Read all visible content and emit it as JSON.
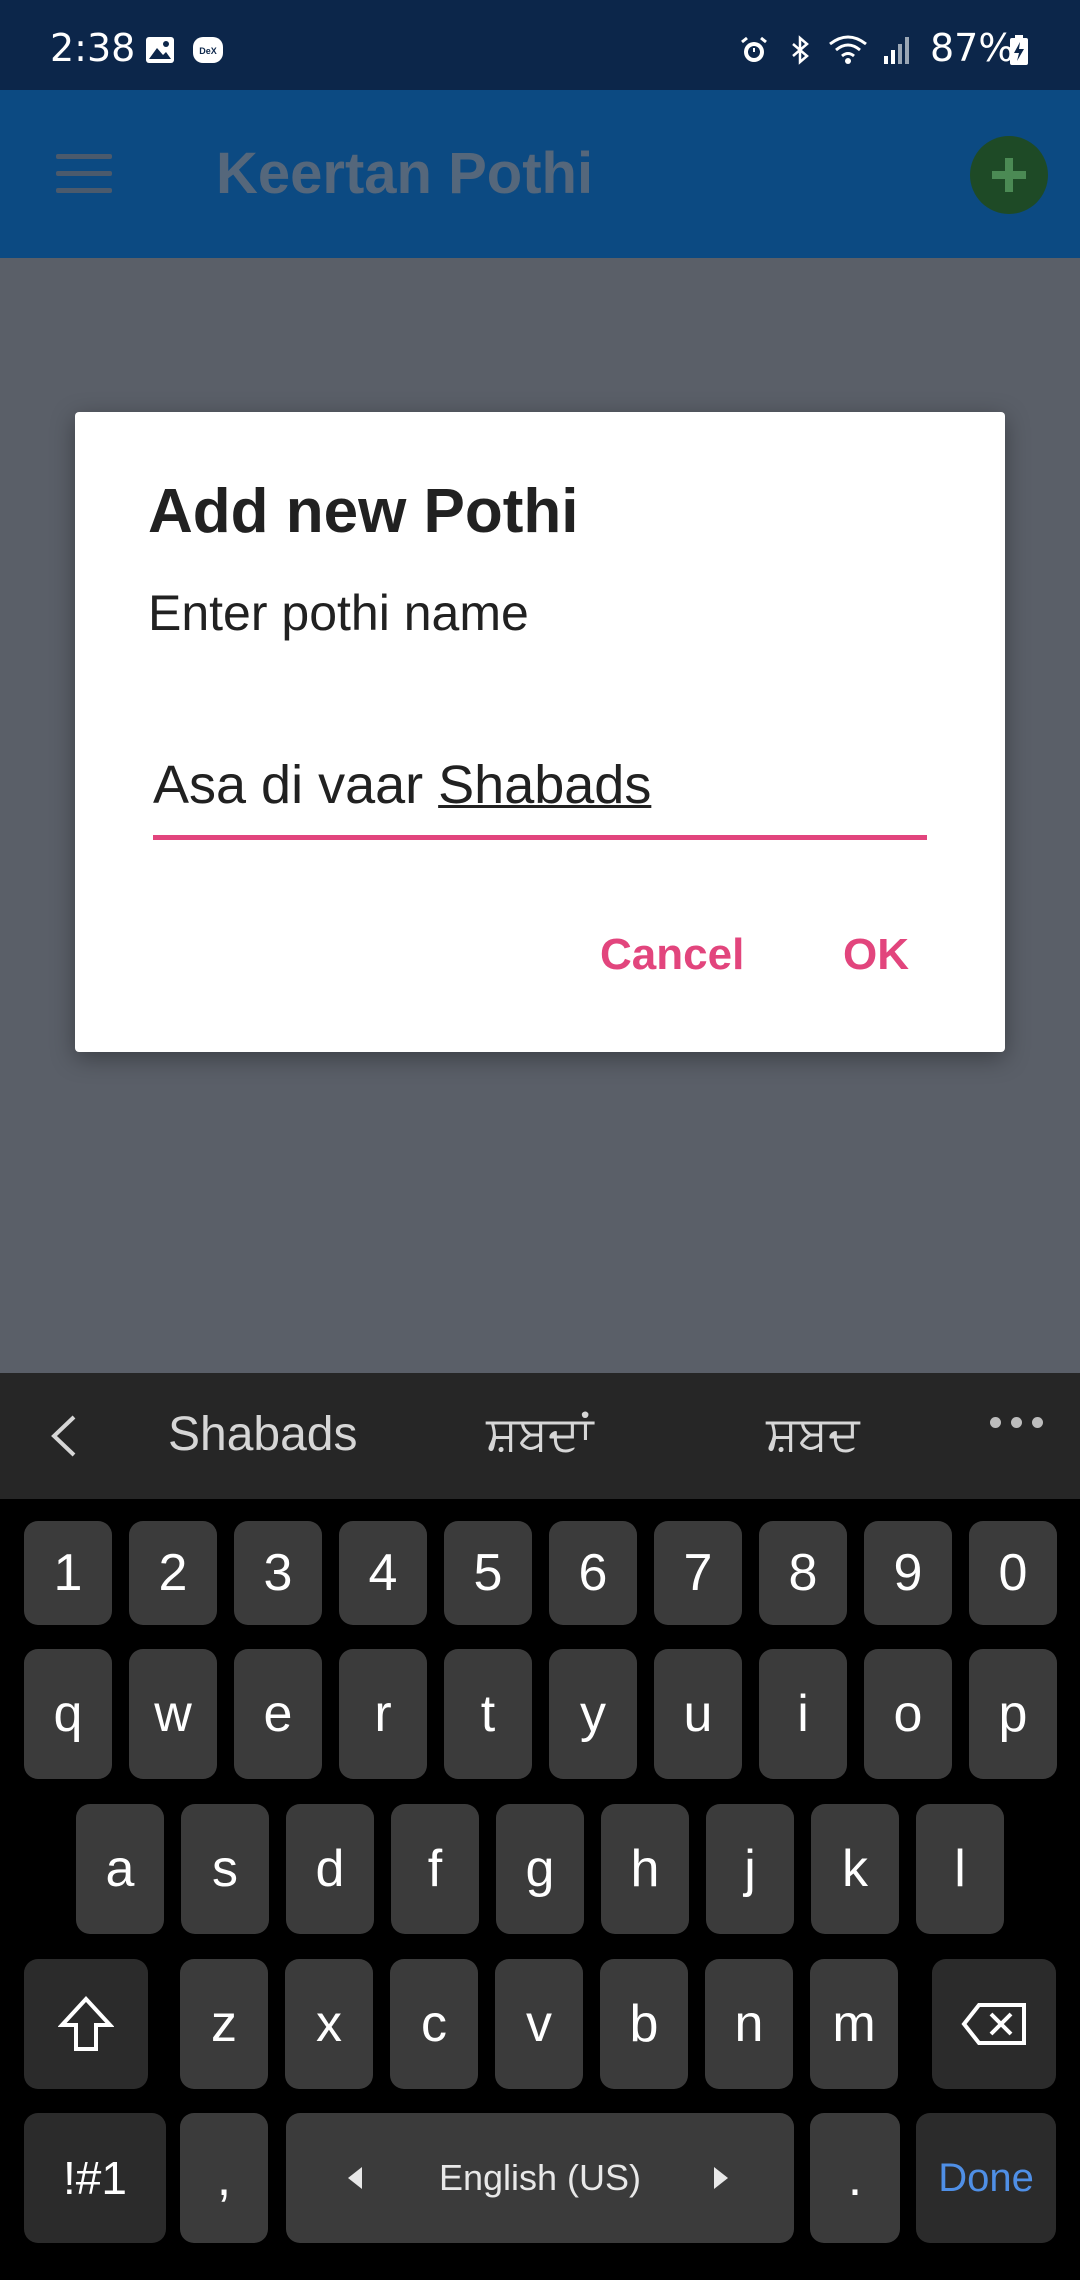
{
  "status_bar": {
    "time": "2:38",
    "battery": "87%",
    "icons": [
      "gallery-icon",
      "dex-icon",
      "alarm-icon",
      "bluetooth-icon",
      "wifi-icon",
      "signal-icon",
      "battery-charging-icon"
    ]
  },
  "app_bar": {
    "title": "Keertan Pothi",
    "menu_icon": "hamburger-menu-icon",
    "add_icon": "plus-icon"
  },
  "dialog": {
    "title": "Add new Pothi",
    "message": "Enter pothi name",
    "input_value_prefix": "Asa di vaar ",
    "input_value_composing": "Shabads",
    "cancel_label": "Cancel",
    "ok_label": "OK",
    "accent_color": "#e2457d"
  },
  "keyboard": {
    "suggestions": [
      "Shabads",
      "ਸ਼ਬਦਾਂ",
      "ਸ਼ਬਦ"
    ],
    "row_numbers": [
      "1",
      "2",
      "3",
      "4",
      "5",
      "6",
      "7",
      "8",
      "9",
      "0"
    ],
    "row_1": [
      "q",
      "w",
      "e",
      "r",
      "t",
      "y",
      "u",
      "i",
      "o",
      "p"
    ],
    "row_2": [
      "a",
      "s",
      "d",
      "f",
      "g",
      "h",
      "j",
      "k",
      "l"
    ],
    "row_3": [
      "z",
      "x",
      "c",
      "v",
      "b",
      "n",
      "m"
    ],
    "symbols_label": "!#1",
    "comma_label": ",",
    "space_label": "English (US)",
    "period_label": ".",
    "done_label": "Done",
    "done_color": "#4f8fe6"
  }
}
